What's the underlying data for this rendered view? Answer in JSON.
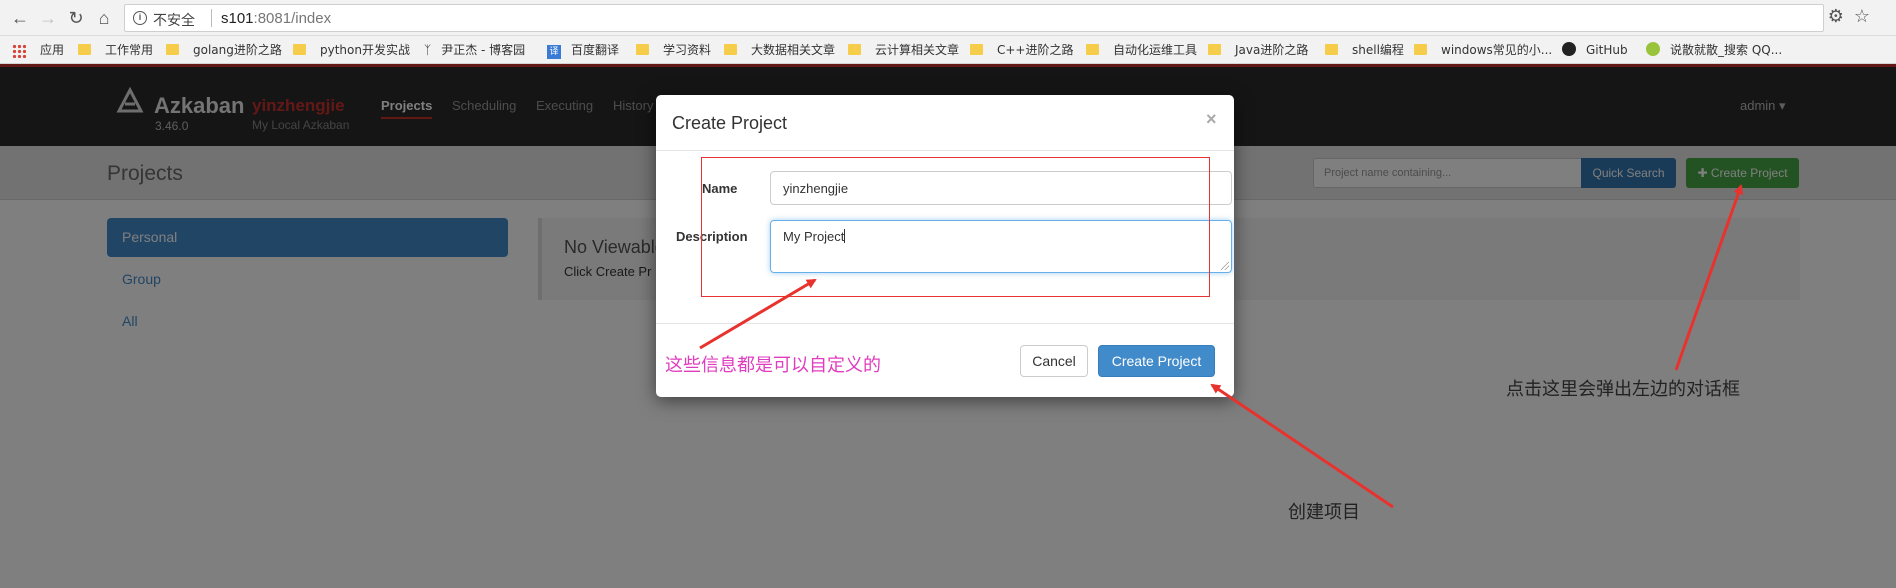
{
  "browser": {
    "security_label": "不安全",
    "url_host": "s101",
    "url_rest": ":8081/index",
    "bookmarks": [
      {
        "label": "应用"
      },
      {
        "label": "工作常用"
      },
      {
        "label": "golang进阶之路"
      },
      {
        "label": "python开发实战"
      },
      {
        "label": "尹正杰 - 博客园"
      },
      {
        "label": "百度翻译"
      },
      {
        "label": "学习资料"
      },
      {
        "label": "大数据相关文章"
      },
      {
        "label": "云计算相关文章"
      },
      {
        "label": "C++进阶之路"
      },
      {
        "label": "自动化运维工具"
      },
      {
        "label": "Java进阶之路"
      },
      {
        "label": "shell编程"
      },
      {
        "label": "windows常见的小..."
      },
      {
        "label": "GitHub"
      },
      {
        "label": "说散就散_搜索 QQ..."
      }
    ]
  },
  "app": {
    "name": "Azkaban",
    "version": "3.46.0",
    "instance_name": "yinzhengjie",
    "instance_subtitle": "My Local Azkaban",
    "nav": [
      "Projects",
      "Scheduling",
      "Executing",
      "History"
    ],
    "user_menu": "admin"
  },
  "projects_page": {
    "title": "Projects",
    "search_placeholder": "Project name containing...",
    "quick_search_label": "Quick Search",
    "create_project_label": "Create Project",
    "sidebar": [
      "Personal",
      "Group",
      "All"
    ],
    "empty_title": "No Viewable",
    "empty_text": "Click Create Pr"
  },
  "modal": {
    "title": "Create Project",
    "close_glyph": "×",
    "name_label": "Name",
    "name_value": "yinzhengjie",
    "description_label": "Description",
    "description_value": "My Project",
    "cancel_label": "Cancel",
    "submit_label": "Create Project"
  },
  "annotations": {
    "custom_info": "这些信息都是可以自定义的",
    "popup_hint": "点击这里会弹出左边的对话框",
    "create_hint": "创建项目"
  },
  "colors": {
    "annotation_pink": "#e03cbf",
    "arrow_red": "#e8322e",
    "brand_red": "#c9302c",
    "primary_blue": "#428bca",
    "success_green": "#47a447"
  }
}
